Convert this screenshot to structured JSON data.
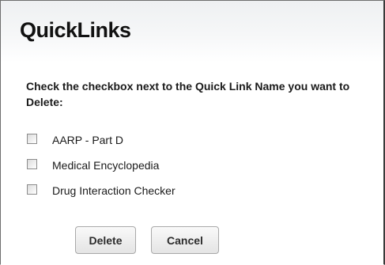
{
  "header": {
    "title": "QuickLinks"
  },
  "instructions": "Check the checkbox next to the Quick Link Name you want to Delete:",
  "quick_links": [
    {
      "label": "AARP - Part D",
      "checked": false
    },
    {
      "label": "Medical Encyclopedia",
      "checked": false
    },
    {
      "label": "Drug Interaction Checker",
      "checked": false
    }
  ],
  "buttons": {
    "delete_label": "Delete",
    "cancel_label": "Cancel"
  }
}
